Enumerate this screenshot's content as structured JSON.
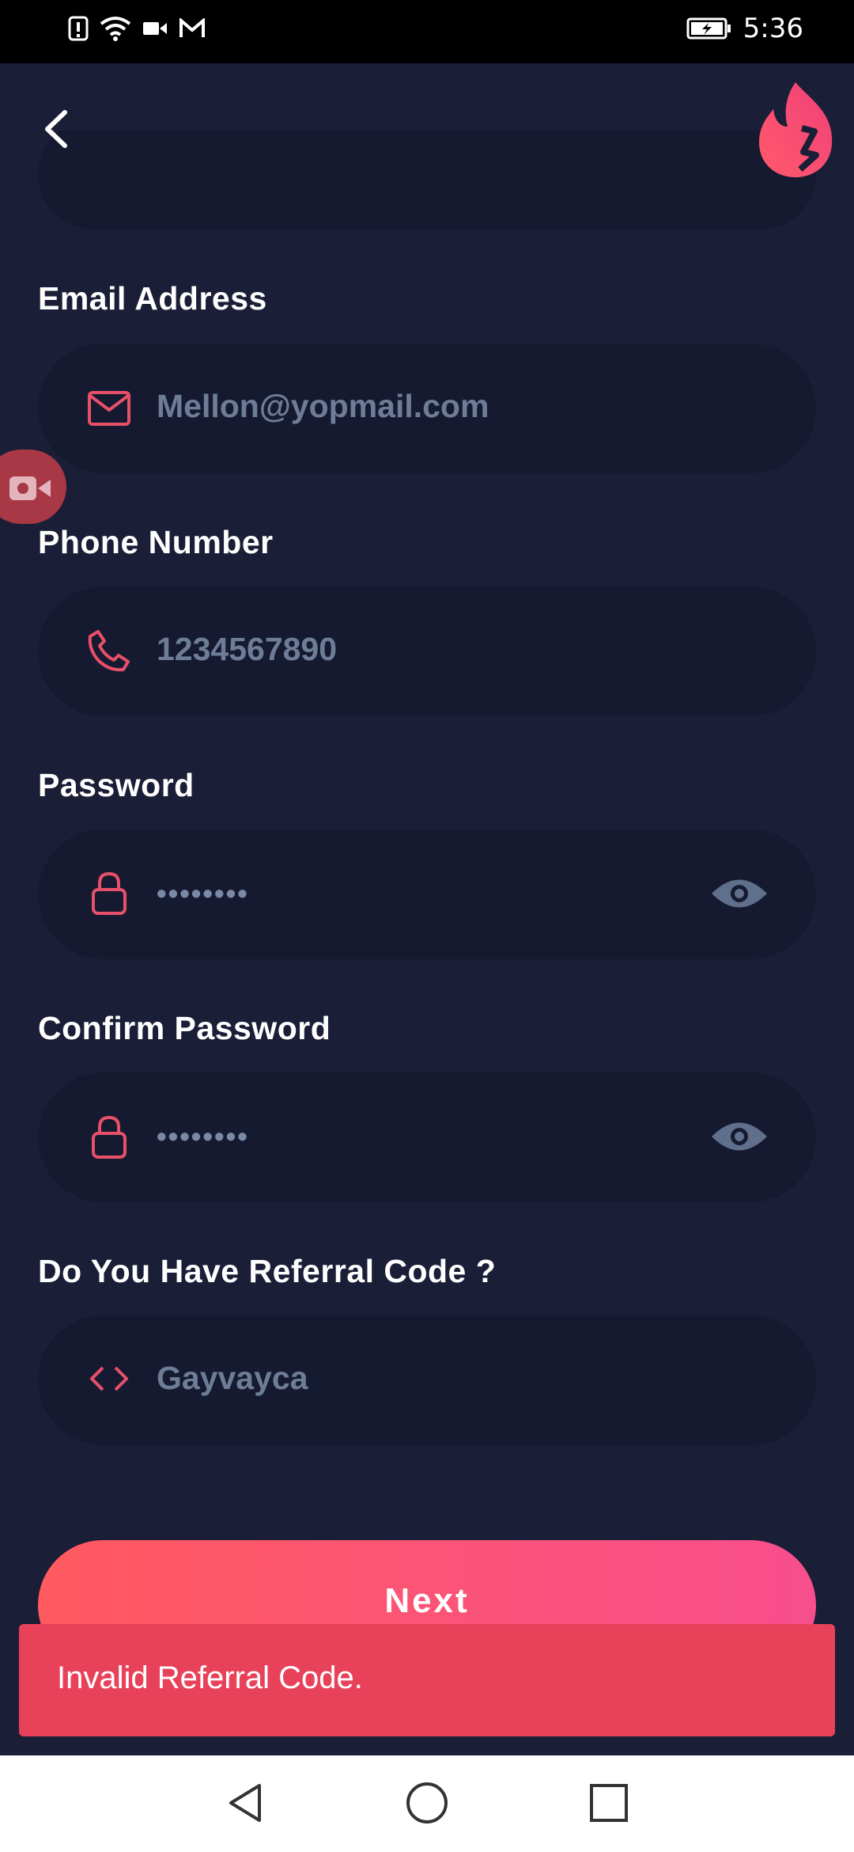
{
  "status_bar": {
    "time": "5:36"
  },
  "form": {
    "email": {
      "label": "Email Address",
      "value": "Mellon@yopmail.com"
    },
    "phone": {
      "label": "Phone Number",
      "value": "1234567890"
    },
    "password": {
      "label": "Password",
      "value": "••••••••"
    },
    "confirm_password": {
      "label": "Confirm Password",
      "value": "••••••••"
    },
    "referral": {
      "label": "Do You Have Referral Code ?",
      "value": "Gayvayca"
    }
  },
  "next_button": {
    "label": "Next"
  },
  "toast": {
    "message": "Invalid Referral Code."
  },
  "colors": {
    "background": "#1b1e37",
    "field": "#161a30",
    "accent": "#ff5a5f",
    "accent_end": "#f74e8d",
    "toast": "#e8425a"
  },
  "icons": [
    "back-icon",
    "flame-logo",
    "mail-icon",
    "phone-icon",
    "lock-icon",
    "eye-icon",
    "code-icon",
    "screen-record-icon",
    "nav-back-icon",
    "nav-home-icon",
    "nav-recents-icon"
  ]
}
